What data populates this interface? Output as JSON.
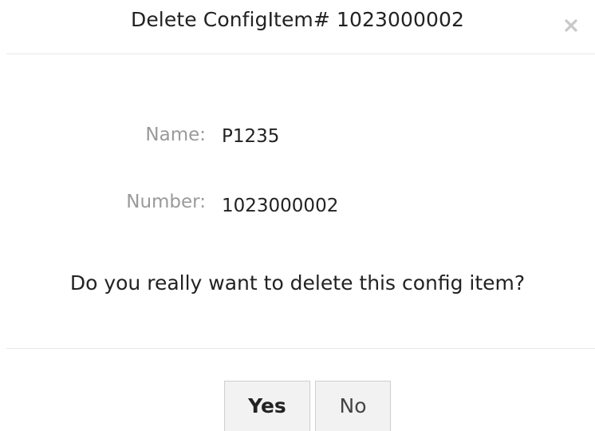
{
  "dialog": {
    "title": "Delete ConfigItem# 1023000002",
    "close_icon": "close-icon",
    "fields": [
      {
        "label": "Name:",
        "value": "P1235"
      },
      {
        "label": "Number:",
        "value": "1023000002"
      }
    ],
    "question": "Do you really want to delete this config item?",
    "buttons": {
      "yes": "Yes",
      "no": "No"
    }
  }
}
